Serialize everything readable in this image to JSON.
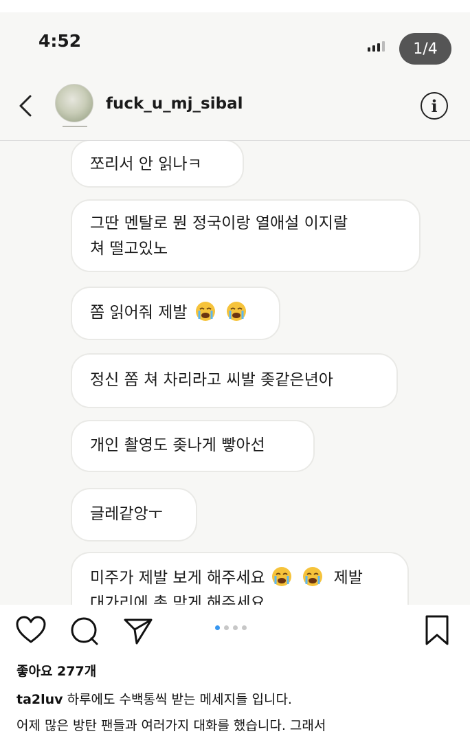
{
  "status_bar": {
    "time": "4:52"
  },
  "pager": {
    "label": "1/4"
  },
  "header": {
    "username": "fuck_u_mj_sibal",
    "info_icon": "info-icon",
    "back_icon": "back-chevron-icon"
  },
  "messages": [
    {
      "text": "쪼리서 안 읽나ㅋ"
    },
    {
      "line1": "그딴 멘탈로 뭔 정국이랑 열애설 이지랄",
      "line2": "쳐 떨고있노"
    },
    {
      "text": "쫌 읽어줘 제발",
      "emoji": "loudly-crying-face"
    },
    {
      "text": "정신 쫌 쳐 차리라고 씨발 좆같은년아"
    },
    {
      "text": "개인 촬영도 좆나게 빻아선"
    },
    {
      "text": "글레같앙ㅜ"
    },
    {
      "line1_a": "미주가 제발 보게 해주세요",
      "line1_b": "제발",
      "line2": "대가리에 총 맞게 해주세요",
      "emoji": "loudly-crying-face"
    }
  ],
  "post": {
    "likes": "좋아요 277개",
    "caption_user": "ta2luv",
    "caption_line1": " 하루에도 수백통씩 받는 메세지들 입니다.",
    "caption_line2": "어제 많은 방탄 팬들과 여러가지 대화를 했습니다. 그래서",
    "carousel_active_index": 1,
    "carousel_count": 4
  },
  "colors": {
    "bubble_border": "#e9e9e6",
    "carousel_active": "#3897f0",
    "pager_bg": "#282828"
  }
}
